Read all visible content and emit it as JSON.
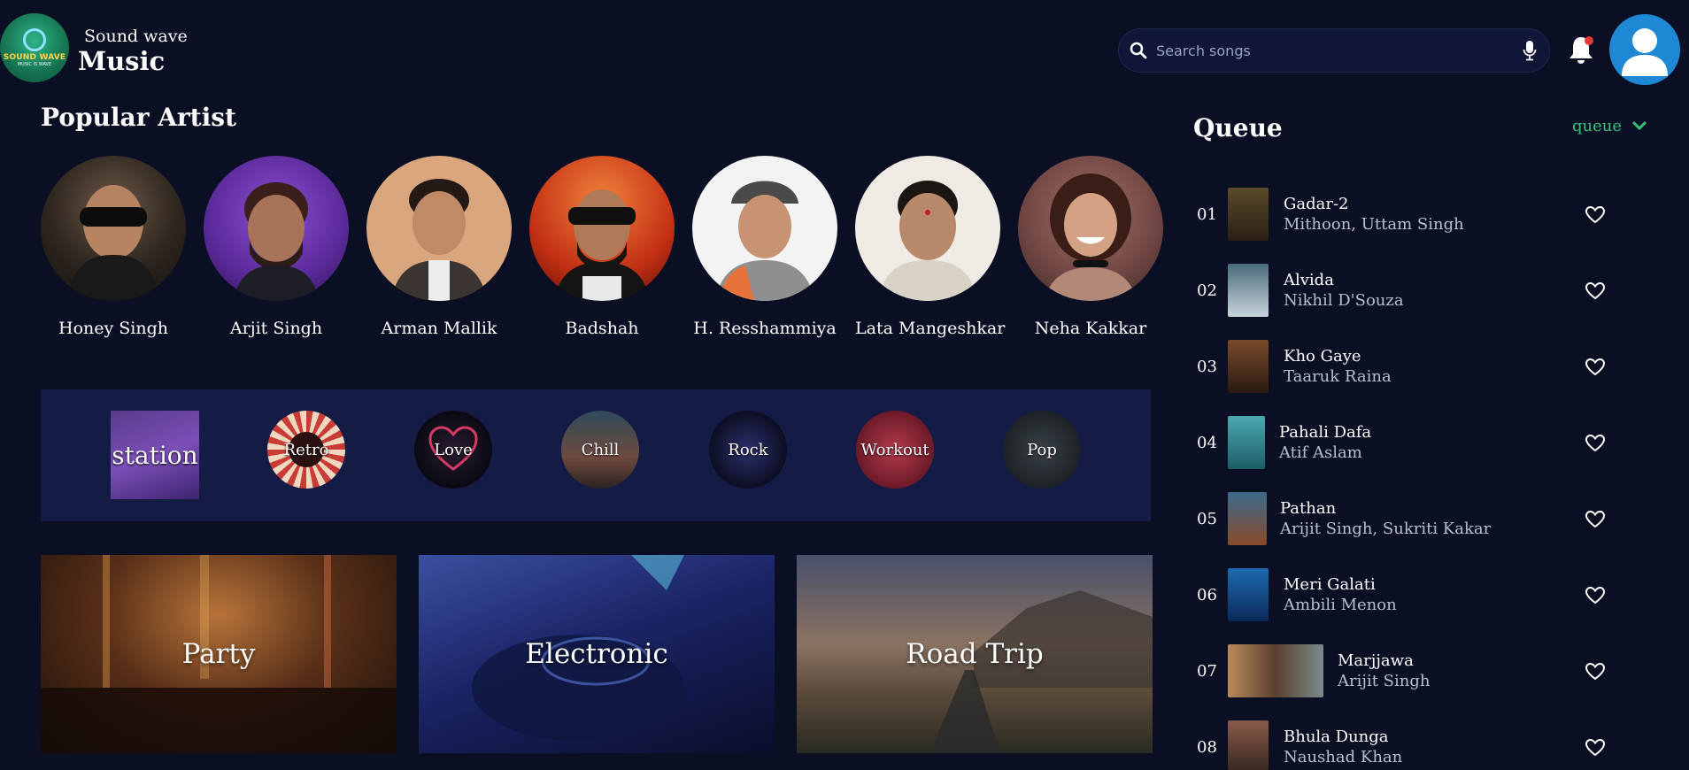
{
  "brand": {
    "subtitle": "Sound wave",
    "title": "Music",
    "logo_text": "SOUND WAVE",
    "logo_tagline": "MUSIC IS WAVE"
  },
  "search": {
    "placeholder": "Search songs",
    "value": ""
  },
  "icons": {
    "search": "search-icon",
    "mic": "mic-icon",
    "bell": "bell-icon",
    "avatar": "user-avatar-icon"
  },
  "colors": {
    "background": "#0b0f24",
    "panel": "#141b45",
    "accent": "#35c27a",
    "notification_dot": "#e53935"
  },
  "popular": {
    "title": "Popular Artist",
    "artists": [
      {
        "name": "Honey Singh"
      },
      {
        "name": "Arjit Singh"
      },
      {
        "name": "Arman Mallik"
      },
      {
        "name": "Badshah"
      },
      {
        "name": "H. Resshammiya"
      },
      {
        "name": "Lata Mangeshkar"
      },
      {
        "name": "Neha Kakkar"
      }
    ]
  },
  "genres": [
    {
      "label": "station"
    },
    {
      "label": "Retro"
    },
    {
      "label": "Love"
    },
    {
      "label": "Chill"
    },
    {
      "label": "Rock"
    },
    {
      "label": "Workout"
    },
    {
      "label": "Pop"
    }
  ],
  "moods": [
    {
      "label": "Party"
    },
    {
      "label": "Electronic"
    },
    {
      "label": "Road Trip"
    }
  ],
  "queue": {
    "title": "Queue",
    "select_label": "queue",
    "items": [
      {
        "num": "01",
        "title": "Gadar-2",
        "artist": "Mithoon, Uttam Singh"
      },
      {
        "num": "02",
        "title": "Alvida",
        "artist": "Nikhil D'Souza"
      },
      {
        "num": "03",
        "title": "Kho Gaye",
        "artist": "Taaruk Raina"
      },
      {
        "num": "04",
        "title": "Pahali Dafa",
        "artist": "Atif Aslam"
      },
      {
        "num": "05",
        "title": "Pathan",
        "artist": "Arijit Singh, Sukriti Kakar"
      },
      {
        "num": "06",
        "title": "Meri Galati",
        "artist": "Ambili Menon"
      },
      {
        "num": "07",
        "title": "Marjjawa",
        "artist": "Arijit Singh"
      },
      {
        "num": "08",
        "title": "Bhula Dunga",
        "artist": "Naushad Khan"
      }
    ]
  }
}
